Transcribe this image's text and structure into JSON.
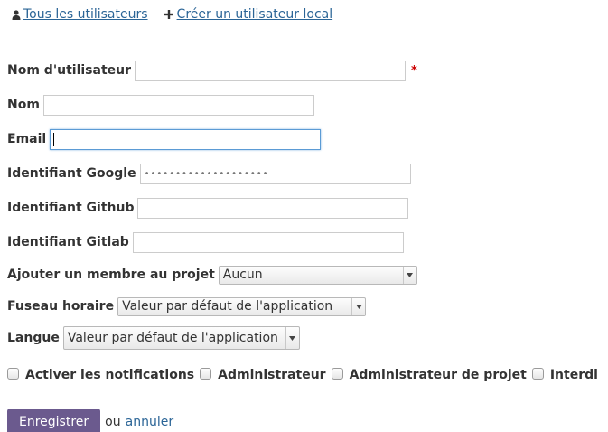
{
  "top_links": {
    "all_users": "Tous les utilisateurs",
    "create_local_user": "Créer un utilisateur local"
  },
  "form": {
    "username": {
      "label": "Nom d'utilisateur",
      "value": "",
      "required_mark": "*"
    },
    "name": {
      "label": "Nom",
      "value": ""
    },
    "email": {
      "label": "Email",
      "value": ""
    },
    "google_id": {
      "label": "Identifiant Google",
      "value": "••••••••••••••••••••"
    },
    "github_id": {
      "label": "Identifiant Github",
      "value": ""
    },
    "gitlab_id": {
      "label": "Identifiant Gitlab",
      "value": ""
    },
    "project_member": {
      "label": "Ajouter un membre au projet",
      "selected": "Aucun"
    },
    "timezone": {
      "label": "Fuseau horaire",
      "selected": "Valeur par défaut de l'application"
    },
    "language": {
      "label": "Langue",
      "selected": "Valeur par défaut de l'application"
    }
  },
  "checkboxes": {
    "notifications": "Activer les notifications",
    "admin": "Administrateur",
    "project_admin": "Administrateur de projet",
    "forbidden": "Interdi"
  },
  "actions": {
    "save": "Enregistrer",
    "or": "ou",
    "cancel": "annuler"
  },
  "colors": {
    "link": "#2a6496",
    "required": "#cc0000",
    "save_button": "#6b5a8e",
    "focus_border": "#5b9bd5"
  }
}
